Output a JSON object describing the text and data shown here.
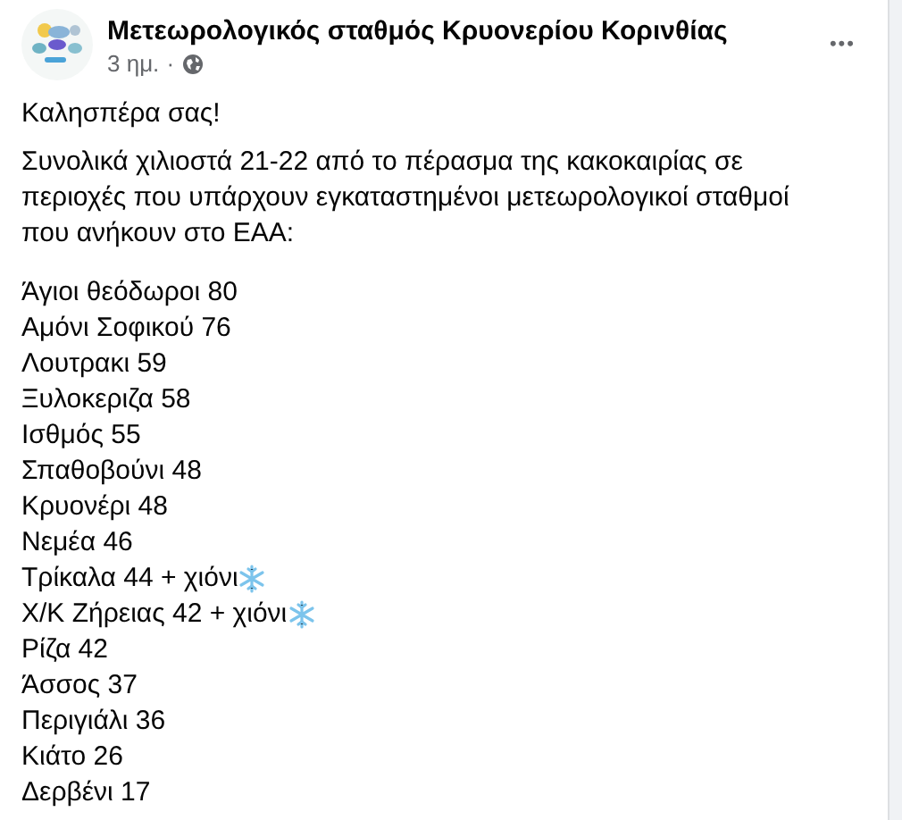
{
  "post": {
    "author": "Μετεωρολογικός σταθμός Κρυονερίου Κορινθίας",
    "time": "3 ημ.",
    "separator": "·",
    "menu": "•••",
    "greeting": "Καλησπέρα σας!",
    "intro": "Συνολικά χιλιοστά 21-22 από το πέρασμα της κακοκαιρίας σε περιοχές που υπάρχουν εγκαταστημένοι μετεωρολογικοί σταθμοί που ανήκουν στο ΕΑΑ:",
    "stations": [
      {
        "text": "Άγιοι θεόδωροι 80",
        "snow": false
      },
      {
        "text": "Αμόνι Σοφικού 76",
        "snow": false
      },
      {
        "text": "Λουτρακι 59",
        "snow": false
      },
      {
        "text": "Ξυλοκεριζα 58",
        "snow": false
      },
      {
        "text": "Ισθμός 55",
        "snow": false
      },
      {
        "text": "Σπαθοβούνι 48",
        "snow": false
      },
      {
        "text": "Κρυονέρι 48",
        "snow": false
      },
      {
        "text": "Νεμέα 46",
        "snow": false
      },
      {
        "text": "Τρίκαλα 44 + χιόνι",
        "snow": true
      },
      {
        "text": "Χ/Κ Ζήρειας 42 + χιόνι",
        "snow": true
      },
      {
        "text": "Ρίζα 42",
        "snow": false
      },
      {
        "text": "Άσσος 37",
        "snow": false
      },
      {
        "text": "Περιγιάλι 36",
        "snow": false
      },
      {
        "text": "Κιάτο 26",
        "snow": false
      },
      {
        "text": "Δερβένι 17",
        "snow": false
      }
    ]
  }
}
